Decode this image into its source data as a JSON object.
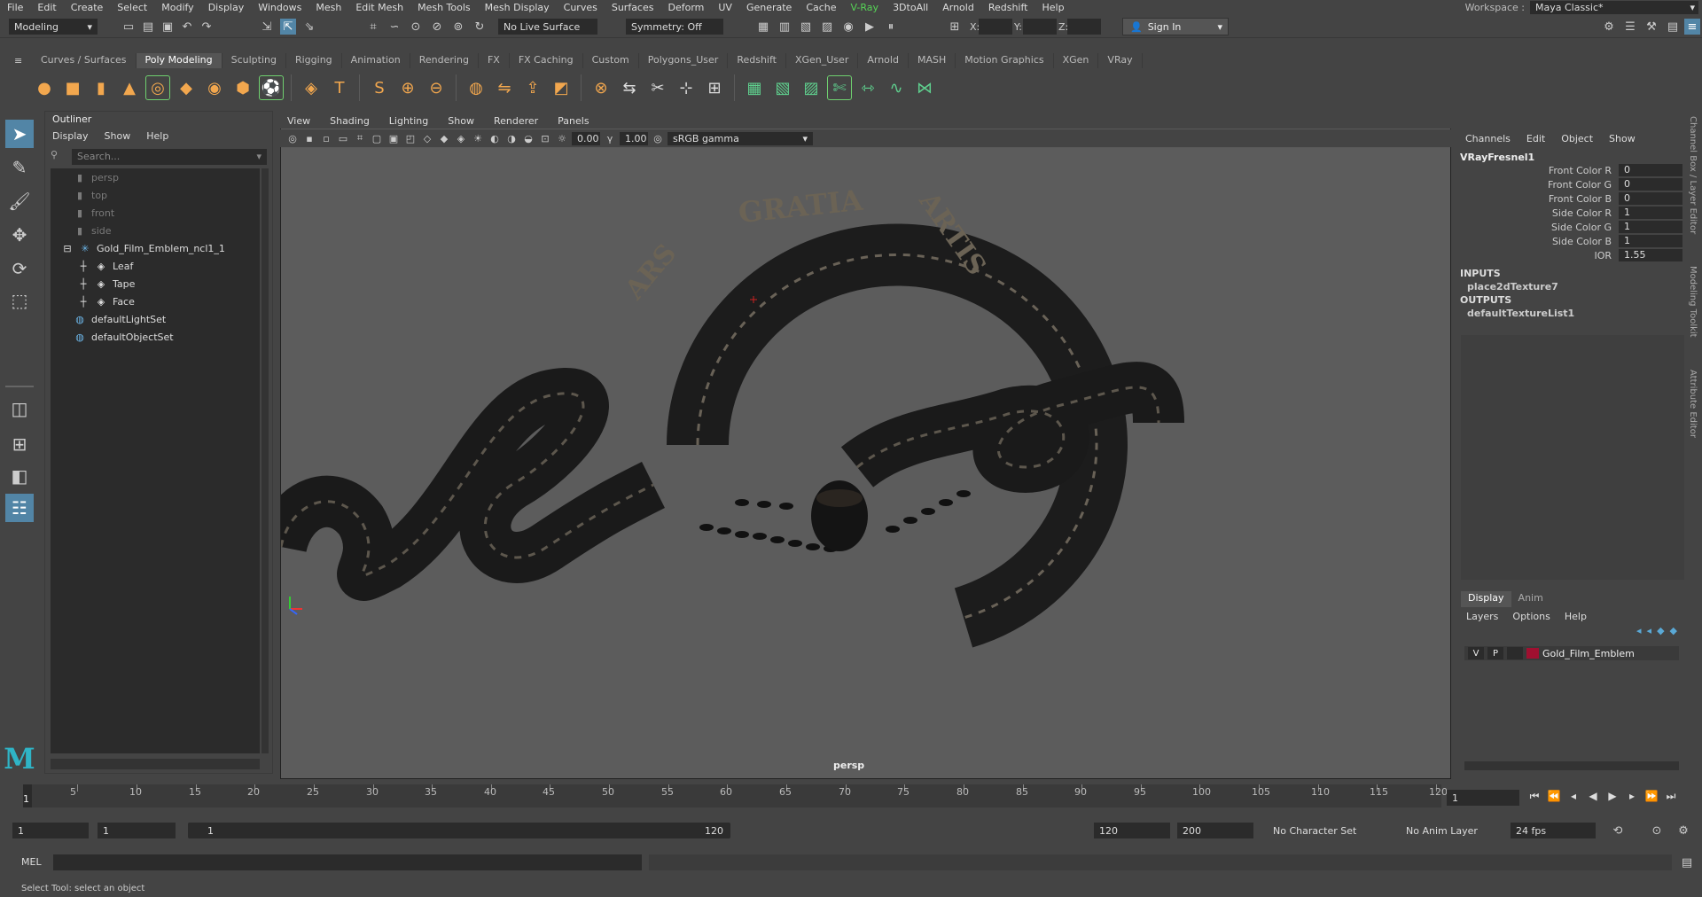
{
  "menubar": {
    "items": [
      "File",
      "Edit",
      "Create",
      "Select",
      "Modify",
      "Display",
      "Windows",
      "Mesh",
      "Edit Mesh",
      "Mesh Tools",
      "Mesh Display",
      "Curves",
      "Surfaces",
      "Deform",
      "UV",
      "Generate",
      "Cache",
      "V-Ray",
      "3DtoAll",
      "Arnold",
      "Redshift",
      "Help"
    ],
    "highlighted": "V-Ray",
    "workspace_label": "Workspace :",
    "workspace_value": "Maya Classic*"
  },
  "statusline": {
    "mode": "Modeling",
    "live_surface": "No Live Surface",
    "symmetry": "Symmetry: Off",
    "x_label": "X:",
    "y_label": "Y:",
    "z_label": "Z:",
    "sign_in": "Sign In"
  },
  "shelf": {
    "tabs": [
      "Curves / Surfaces",
      "Poly Modeling",
      "Sculpting",
      "Rigging",
      "Animation",
      "Rendering",
      "FX",
      "FX Caching",
      "Custom",
      "Polygons_User",
      "Redshift",
      "XGen_User",
      "Arnold",
      "MASH",
      "Motion Graphics",
      "XGen",
      "VRay"
    ],
    "active_tab": "Poly Modeling",
    "icons": [
      "sphere",
      "cube",
      "cylinder",
      "cone",
      "torus",
      "plane",
      "disc",
      "platonic",
      "soccer-ball",
      "superellipse",
      "type",
      "svg",
      "combine",
      "separate",
      "smooth",
      "bridge",
      "extrude",
      "bevel",
      "boolean",
      "mirror",
      "multi-cut",
      "target-weld",
      "quad-draw",
      "uv-editor",
      "uv-unfold",
      "planar",
      "cut",
      "mirror-geo",
      "sew",
      "split"
    ]
  },
  "outliner": {
    "title": "Outliner",
    "menu": [
      "Display",
      "Show",
      "Help"
    ],
    "search_placeholder": "Search...",
    "items": [
      {
        "label": "persp",
        "dim": true,
        "indent": 1,
        "icon": "camera-icon"
      },
      {
        "label": "top",
        "dim": true,
        "indent": 1,
        "icon": "camera-icon"
      },
      {
        "label": "front",
        "dim": true,
        "indent": 1,
        "icon": "camera-icon"
      },
      {
        "label": "side",
        "dim": true,
        "indent": 1,
        "icon": "camera-icon"
      },
      {
        "label": "Gold_Film_Emblem_ncl1_1",
        "dim": false,
        "indent": 0,
        "icon": "group-icon"
      },
      {
        "label": "Leaf",
        "dim": false,
        "indent": 2,
        "icon": "mesh-icon"
      },
      {
        "label": "Tape",
        "dim": false,
        "indent": 2,
        "icon": "mesh-icon"
      },
      {
        "label": "Face",
        "dim": false,
        "indent": 2,
        "icon": "mesh-icon"
      },
      {
        "label": "defaultLightSet",
        "dim": false,
        "indent": 1,
        "icon": "set-icon"
      },
      {
        "label": "defaultObjectSet",
        "dim": false,
        "indent": 1,
        "icon": "set-icon"
      }
    ]
  },
  "viewport": {
    "menu": [
      "View",
      "Shading",
      "Lighting",
      "Show",
      "Renderer",
      "Panels"
    ],
    "exposure": "0.00",
    "gamma": "1.00",
    "color_space": "sRGB gamma",
    "camera": "persp",
    "emblem_text": [
      "GRATIA",
      "ARS",
      "ARTIS"
    ]
  },
  "channelbox": {
    "menu": [
      "Channels",
      "Edit",
      "Object",
      "Show"
    ],
    "node": "VRayFresnel1",
    "attrs": [
      {
        "name": "Front Color R",
        "value": "0"
      },
      {
        "name": "Front Color G",
        "value": "0"
      },
      {
        "name": "Front Color B",
        "value": "0"
      },
      {
        "name": "Side Color R",
        "value": "1"
      },
      {
        "name": "Side Color G",
        "value": "1"
      },
      {
        "name": "Side Color B",
        "value": "1"
      },
      {
        "name": "IOR",
        "value": "1.55"
      }
    ],
    "inputs_label": "INPUTS",
    "input": "place2dTexture7",
    "outputs_label": "OUTPUTS",
    "output": "defaultTextureList1",
    "side_tabs": [
      "Channel Box / Layer Editor",
      "Modeling Toolkit",
      "Attribute Editor"
    ]
  },
  "layers": {
    "tabs": [
      "Display",
      "Anim"
    ],
    "active_tab": "Display",
    "menu": [
      "Layers",
      "Options",
      "Help"
    ],
    "layer": {
      "v": "V",
      "p": "P",
      "name": "Gold_Film_Emblem",
      "color": "#a01030"
    }
  },
  "timeline": {
    "ticks": [
      5,
      10,
      15,
      20,
      25,
      30,
      35,
      40,
      45,
      50,
      55,
      60,
      65,
      70,
      75,
      80,
      85,
      90,
      95,
      100,
      105,
      110,
      115,
      120
    ],
    "start_marker": "1",
    "current_frame": "1"
  },
  "range": {
    "start": "1",
    "anim_start": "1",
    "slider_start": "1",
    "slider_end": "120",
    "end": "120",
    "anim_end": "200",
    "character_set": "No Character Set",
    "anim_layer": "No Anim Layer",
    "fps": "24 fps"
  },
  "command": {
    "label": "MEL"
  },
  "status": {
    "text": "Select Tool: select an object"
  },
  "colors": {
    "accent": "#5285a6",
    "highlight_green": "#56d356",
    "maya_logo": "#2fb4c6"
  }
}
